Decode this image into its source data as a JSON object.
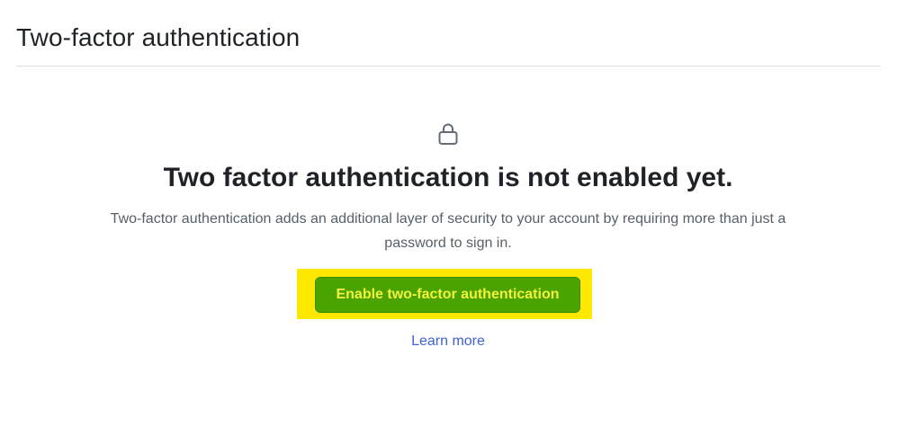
{
  "header": {
    "title": "Two-factor authentication"
  },
  "blankslate": {
    "icon": "lock-icon",
    "heading": "Two factor authentication is not enabled yet.",
    "description_line1": "Two-factor authentication adds an additional layer of security to your account by requiring more than just a",
    "description_line2": "password to sign in.",
    "enable_button_label": "Enable two-factor authentication",
    "learn_more_label": "Learn more"
  },
  "colors": {
    "button_bg": "#4aa300",
    "button_text": "#f2f23a",
    "highlight": "#ffe800",
    "link": "#3d63cc"
  }
}
